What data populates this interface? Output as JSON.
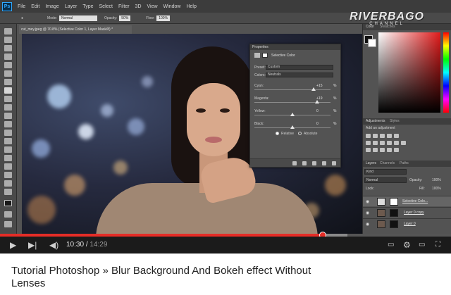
{
  "photoshop": {
    "logo": "Ps",
    "menu": [
      "File",
      "Edit",
      "Image",
      "Layer",
      "Type",
      "Select",
      "Filter",
      "3D",
      "View",
      "Window",
      "Help"
    ],
    "options_bar": {
      "mode_label": "Mode:",
      "mode_value": "Normal",
      "opacity_label": "Opacity:",
      "opacity_value": "50%",
      "flow_label": "Flow:",
      "flow_value": "100%"
    },
    "document_tab": "cut_mey.jpeg @ 70.8% (Selective Color 1, Layer Mask/8) *",
    "properties": {
      "header": "Properties",
      "title": "Selective Color",
      "preset_label": "Preset:",
      "preset_value": "Custom",
      "colors_label": "Colors:",
      "colors_value": "Neutrals",
      "sliders": [
        {
          "label": "Cyan:",
          "value": "+15",
          "pct": 0.78
        },
        {
          "label": "Magenta:",
          "value": "+19",
          "pct": 0.82
        },
        {
          "label": "Yellow:",
          "value": "0",
          "pct": 0.5
        },
        {
          "label": "Black:",
          "value": "0",
          "pct": 0.5
        }
      ],
      "unit": "%",
      "radio_relative": "Relative",
      "radio_absolute": "Absolute"
    },
    "panels": {
      "color_tab": "Color",
      "swatches_tab": "Swatches",
      "adjustments_tab": "Adjustments",
      "styles_tab": "Styles",
      "add_adjustment": "Add an adjustment",
      "layers_tab": "Layers",
      "channels_tab": "Channels",
      "paths_tab": "Paths",
      "kind_filter": "Kind",
      "blend_mode": "Normal",
      "opacity_label": "Opacity:",
      "opacity_value": "100%",
      "lock_label": "Lock:",
      "fill_label": "Fill:",
      "fill_value": "100%",
      "layers": [
        "Selective Colo...",
        "Layer 0 copy",
        "Layer 0"
      ]
    }
  },
  "watermark": {
    "title": "RIVERBAGO",
    "subtitle": "CHANNEL"
  },
  "player": {
    "current_time": "10:30",
    "total_time": "14:29",
    "played_fraction": 0.715,
    "buffered_fraction": 0.77,
    "icons": [
      "play-icon",
      "next-icon",
      "volume-icon",
      "captions-icon",
      "settings-icon",
      "miniplayer-icon",
      "fullscreen-icon"
    ]
  },
  "video_title": "Tutorial Photoshop » Blur Background And Bokeh effect Without Lenses",
  "colors": {
    "progress": "#e52d27",
    "controls_bg": "#1b1b1b",
    "ps_bg": "#535353"
  }
}
